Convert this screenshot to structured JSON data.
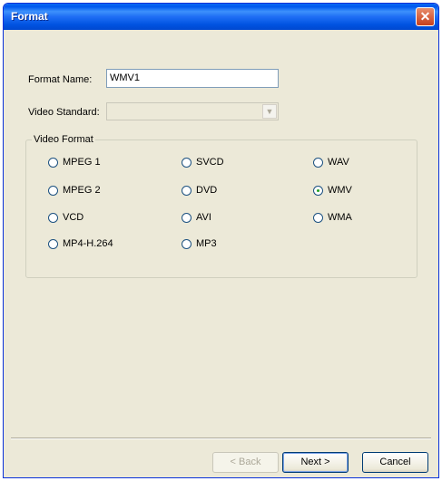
{
  "window": {
    "title": "Format",
    "close_glyph": "✕"
  },
  "form": {
    "format_name_label": "Format Name:",
    "format_name_value": "WMV1",
    "video_standard_label": "Video Standard:",
    "video_standard_value": ""
  },
  "video_format": {
    "group_title": "Video Format",
    "options": [
      {
        "label": "MPEG 1",
        "checked": false
      },
      {
        "label": "MPEG 2",
        "checked": false
      },
      {
        "label": "VCD",
        "checked": false
      },
      {
        "label": "MP4-H.264",
        "checked": false
      },
      {
        "label": "SVCD",
        "checked": false
      },
      {
        "label": "DVD",
        "checked": false
      },
      {
        "label": "AVI",
        "checked": false
      },
      {
        "label": "MP3",
        "checked": false
      },
      {
        "label": "WAV",
        "checked": false
      },
      {
        "label": "WMV",
        "checked": true
      },
      {
        "label": "WMA",
        "checked": false
      }
    ]
  },
  "buttons": {
    "back": "< Back",
    "next": "Next >",
    "cancel": "Cancel"
  }
}
